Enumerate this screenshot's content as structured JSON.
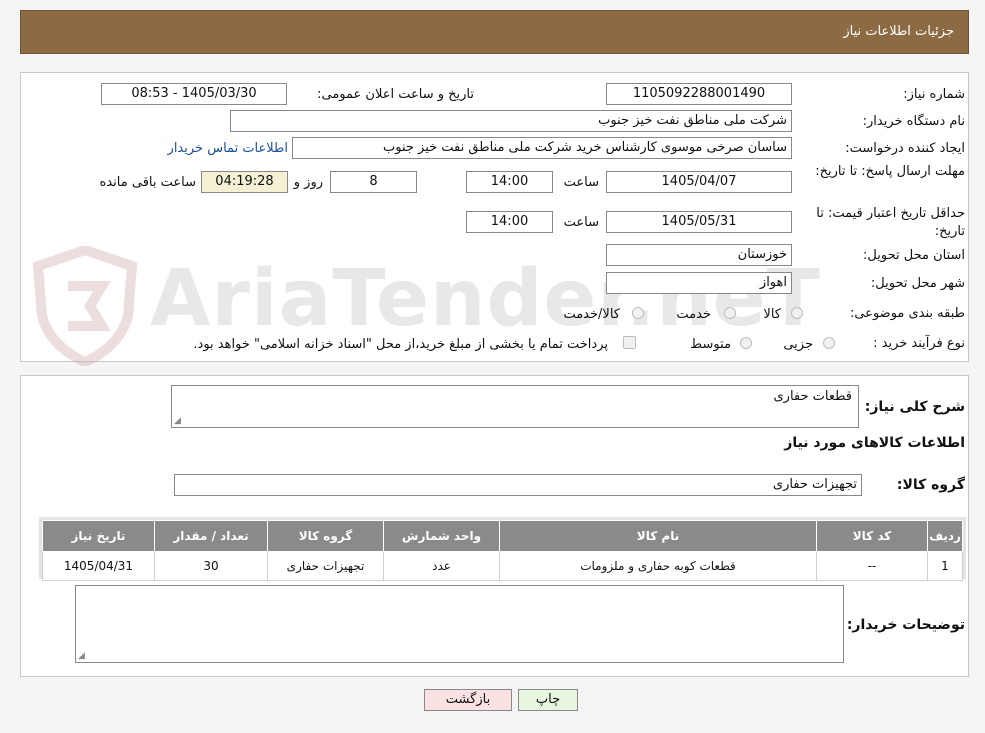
{
  "header": {
    "title": "جزئیات اطلاعات نیاز"
  },
  "form": {
    "need_number_label": "شماره نیاز:",
    "need_number": "1105092288001490",
    "announce_label": "تاریخ و ساعت اعلان عمومی:",
    "announce_value": "1405/03/30 - 08:53",
    "buyer_org_label": "نام دستگاه خریدار:",
    "buyer_org": "شرکت ملی مناطق نفت خیز جنوب",
    "requester_label": "ایجاد کننده درخواست:",
    "requester": "ساسان صرخی موسوی کارشناس خرید  شرکت ملی مناطق نفت خیز جنوب",
    "contact_link": "اطلاعات تماس خریدار",
    "deadline_label": "مهلت ارسال پاسخ: تا تاریخ:",
    "deadline_date": "1405/04/07",
    "time_label": "ساعت",
    "deadline_time": "14:00",
    "days_value": "8",
    "days_label": "روز و",
    "remaining_time": "04:19:28",
    "remaining_label": "ساعت باقی مانده",
    "price_valid_label": "حداقل تاریخ اعتبار قیمت: تا تاریخ:",
    "price_valid_date": "1405/05/31",
    "price_valid_time": "14:00",
    "province_label": "استان محل تحویل:",
    "province": "خوزستان",
    "city_label": "شهر محل تحویل:",
    "city": "اهواز",
    "category_label": "طبقه بندی موضوعی:",
    "category_options": [
      "کالا",
      "خدمت",
      "کالا/خدمت"
    ],
    "process_label": "نوع فرآیند خرید :",
    "process_options": [
      "جزیی",
      "متوسط"
    ],
    "payment_note": "پرداخت تمام یا بخشی از مبلغ خرید،از محل \"اسناد خزانه اسلامی\" خواهد بود."
  },
  "watermark": {
    "text": "AriaTender.neT"
  },
  "details": {
    "description_label": "شرح کلی نیاز:",
    "description": "قطعات حفاری",
    "goods_info_title": "اطلاعات کالاهای مورد نیاز",
    "goods_group_label": "گروه کالا:",
    "goods_group": "تجهیزات حفاری",
    "table": {
      "headers": [
        "ردیف",
        "کد کالا",
        "نام کالا",
        "واحد شمارش",
        "گروه کالا",
        "تعداد / مقدار",
        "تاریخ نیاز"
      ],
      "rows": [
        [
          "1",
          "--",
          "قطعات کوبه حفاری و ملزومات",
          "عدد",
          "تجهیزات حفاری",
          "30",
          "1405/04/31"
        ]
      ]
    },
    "buyer_notes_label": "توضیحات خریدار:",
    "buyer_notes": ""
  },
  "buttons": {
    "print": "چاپ",
    "back": "بازگشت"
  },
  "colors": {
    "header_bg": "#8c6a43",
    "table_header_bg": "#8a8a8a",
    "print_bg": "#e8f6e0",
    "back_bg": "#fbe2e2"
  }
}
